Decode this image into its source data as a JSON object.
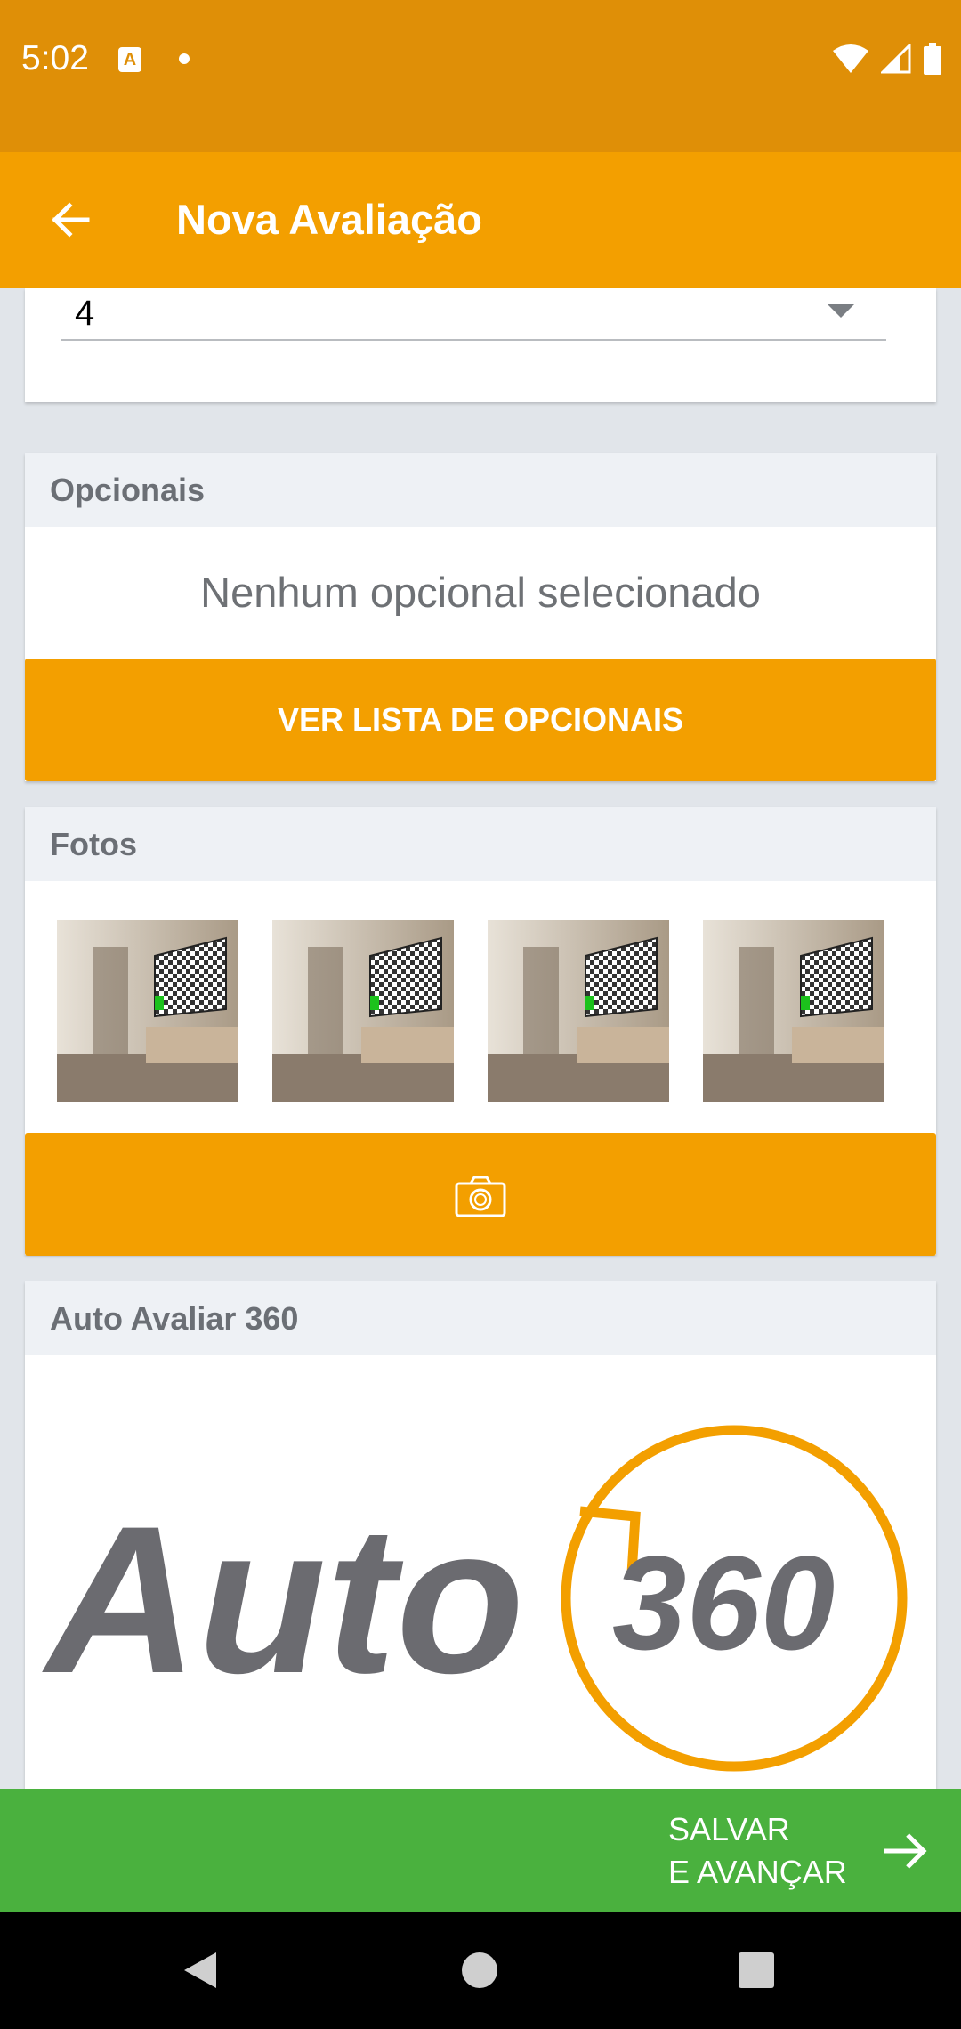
{
  "status_bar": {
    "time": "5:02"
  },
  "app_bar": {
    "title": "Nova Avaliação"
  },
  "select_field": {
    "value": "4"
  },
  "opcionais": {
    "header": "Opcionais",
    "empty_text": "Nenhum opcional selecionado",
    "button_label": "VER LISTA DE OPCIONAIS"
  },
  "fotos": {
    "header": "Fotos",
    "photos": [
      "room-photo",
      "room-photo",
      "room-photo",
      "room-photo"
    ],
    "camera_icon": "camera-icon"
  },
  "auto360": {
    "header": "Auto Avaliar 360",
    "logo_word": "Auto",
    "logo_number": "360"
  },
  "save_bar": {
    "line1": "SALVAR",
    "line2": "E AVANÇAR"
  },
  "colors": {
    "status": "#df8f07",
    "primary": "#f39f00",
    "save": "#4ab13e"
  }
}
